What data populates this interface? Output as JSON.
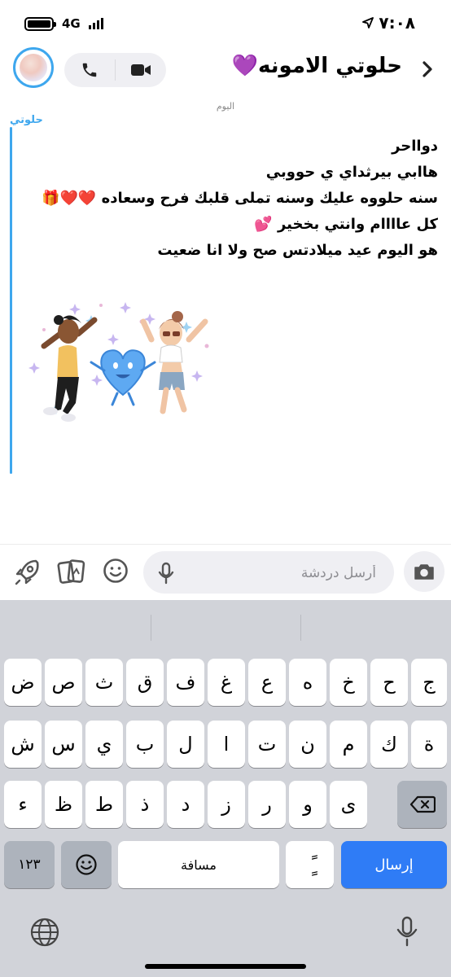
{
  "status_bar": {
    "network": "4G",
    "time": "٧:٠٨"
  },
  "header": {
    "contact_name": "حلوتي الامونه💜"
  },
  "chat": {
    "date_label": "اليوم",
    "sender": "حلوتي",
    "lines": [
      "دوااحر",
      "هاابي بيرثداي ي حووبي",
      "سنه حلووه عليك وسنه تملى قلبك فرح وسعاده ❤️❤️🎁",
      "كل عاااام وانتي بخخير 💕",
      "هو اليوم عيد ميلادتس صح ولا انا ضعيت"
    ]
  },
  "input": {
    "placeholder": "أرسل دردشة"
  },
  "keyboard": {
    "row1": [
      "ض",
      "ص",
      "ث",
      "ق",
      "ف",
      "غ",
      "ع",
      "ه",
      "خ",
      "ح",
      "ج"
    ],
    "row2": [
      "ش",
      "س",
      "ي",
      "ب",
      "ل",
      "ا",
      "ت",
      "ن",
      "م",
      "ك",
      "ة"
    ],
    "row3": [
      "ء",
      "ظ",
      "ط",
      "ذ",
      "د",
      "ز",
      "ر",
      "و",
      "ى"
    ],
    "numbers_label": "١٢٣",
    "space_label": "مسافة",
    "tanween_label": "ًٍ",
    "send_label": "إرسال"
  },
  "colors": {
    "accent": "#3ea7ee",
    "send_key": "#2f7cf6",
    "keyboard_bg": "#d1d3d9"
  }
}
